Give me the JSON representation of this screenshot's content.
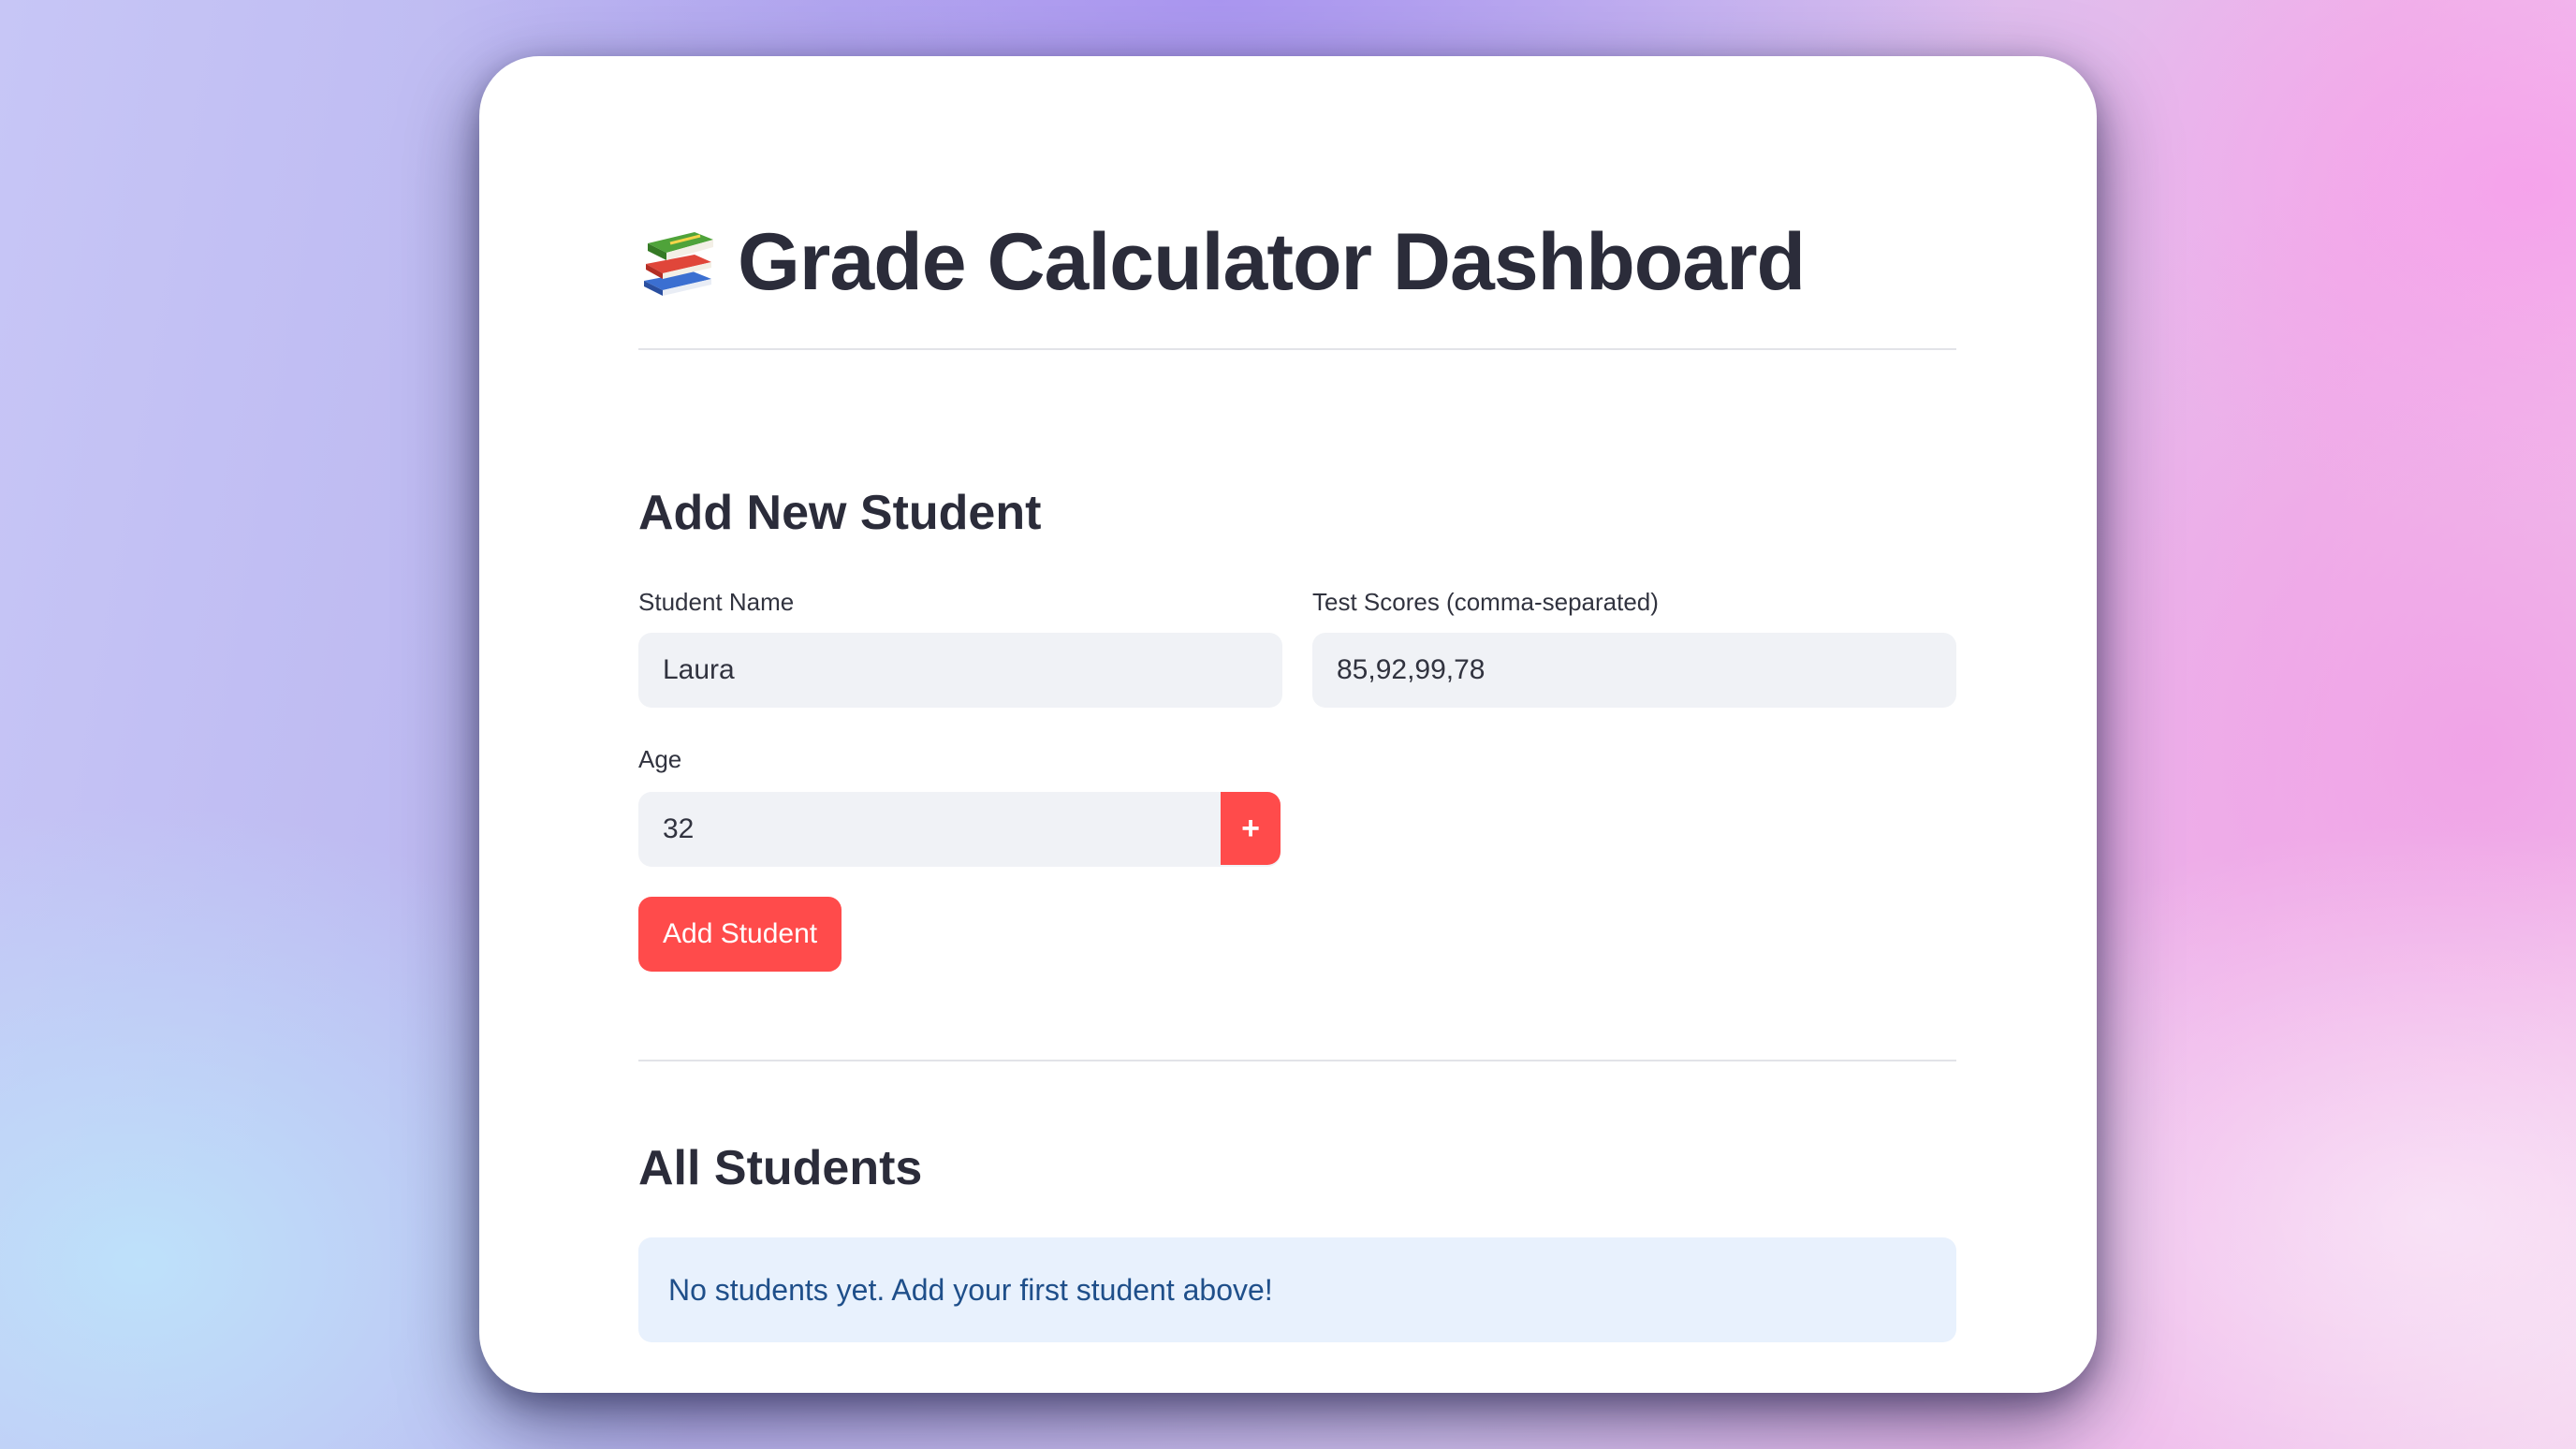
{
  "header": {
    "title": "Grade Calculator Dashboard",
    "title_icon": "books-icon"
  },
  "add_section": {
    "heading": "Add New Student",
    "name_label": "Student Name",
    "name_value": "Laura",
    "scores_label": "Test Scores (comma-separated)",
    "scores_value": "85,92,99,78",
    "age_label": "Age",
    "age_value": "32",
    "minus_symbol": "−",
    "plus_symbol": "+",
    "submit_label": "Add Student"
  },
  "students_section": {
    "heading": "All Students",
    "empty_message": "No students yet. Add your first student above!"
  },
  "colors": {
    "accent": "#ff4b4b",
    "info_background": "#e8f1fd",
    "info_text": "#1f4f8a",
    "input_background": "#f0f2f6",
    "text": "#31333f"
  }
}
